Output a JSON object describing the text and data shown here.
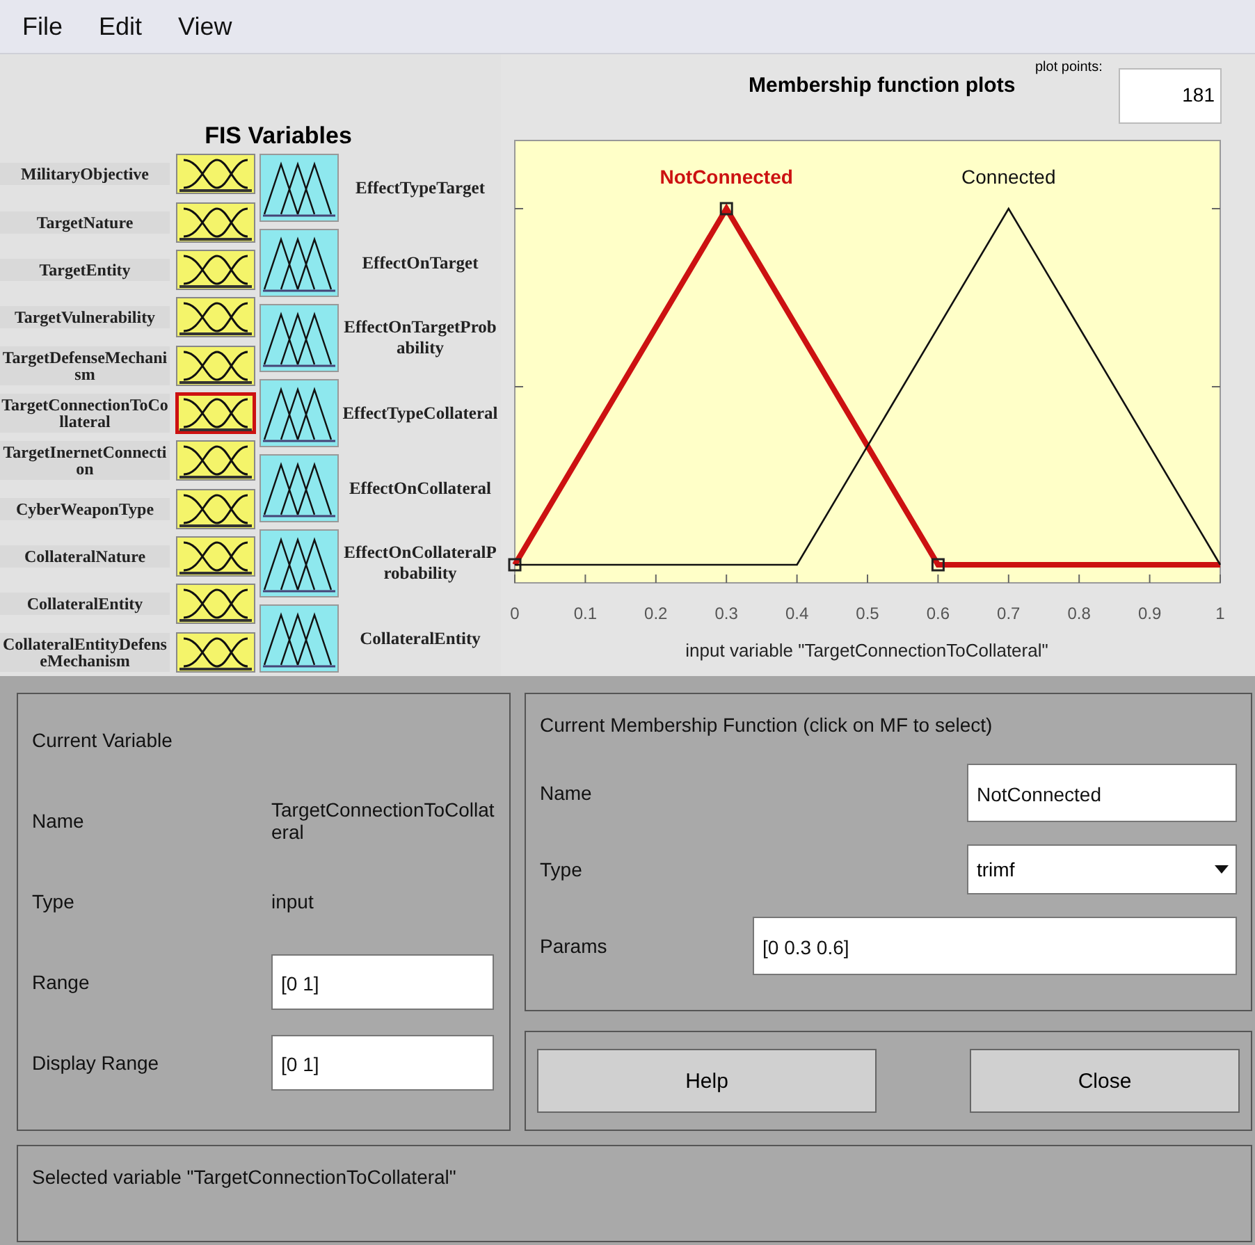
{
  "menu": [
    "File",
    "Edit",
    "View"
  ],
  "fis_variables": {
    "title": "FIS Variables",
    "inputs": [
      {
        "name": "MilitaryObjective",
        "selected": false
      },
      {
        "name": "TargetNature",
        "selected": false
      },
      {
        "name": "TargetEntity",
        "selected": false
      },
      {
        "name": "TargetVulnerability",
        "selected": false
      },
      {
        "name": "TargetDefenseMechanism",
        "selected": false
      },
      {
        "name": "TargetConnectionToCollateral",
        "selected": true
      },
      {
        "name": "TargetInernetConnection",
        "selected": false
      },
      {
        "name": "CyberWeaponType",
        "selected": false
      },
      {
        "name": "CollateralNature",
        "selected": false
      },
      {
        "name": "CollateralEntity",
        "selected": false
      },
      {
        "name": "CollateralEntityDefenseMechanism",
        "selected": false
      }
    ],
    "outputs": [
      "EffectTypeTarget",
      "EffectOnTarget",
      "EffectOnTargetProbability",
      "EffectTypeCollateral",
      "EffectOnCollateral",
      "EffectOnCollateralProbability",
      "CollateralEntity"
    ]
  },
  "plot": {
    "plot_points_label": "plot points:",
    "plot_points": "181",
    "title": "Membership function plots",
    "mfs": [
      {
        "name": "NotConnected",
        "color": "#cc1111",
        "selected": true
      },
      {
        "name": "Connected",
        "color": "#111111",
        "selected": false
      }
    ],
    "x_tick_labels": [
      "0",
      "0.1",
      "0.2",
      "0.3",
      "0.4",
      "0.5",
      "0.6",
      "0.7",
      "0.8",
      "0.9",
      "1"
    ],
    "xlabel": "input variable \"TargetConnectionToCollateral\""
  },
  "current_variable": {
    "title": "Current Variable",
    "fields": [
      {
        "kind": "text",
        "label": "Name",
        "value": "TargetConnectionToCollateral"
      },
      {
        "kind": "text",
        "label": "Type",
        "value": "input"
      },
      {
        "kind": "input",
        "label": "Range",
        "value": "[0 1]"
      },
      {
        "kind": "input",
        "label": "Display Range",
        "value": "[0 1]"
      }
    ]
  },
  "current_mf": {
    "title": "Current Membership Function (click on MF to select)",
    "name": {
      "label": "Name",
      "value": "NotConnected"
    },
    "type": {
      "label": "Type",
      "value": "trimf"
    },
    "params": {
      "label": "Params",
      "value": "[0 0.3 0.6]"
    }
  },
  "buttons": [
    "Help",
    "Close"
  ],
  "status_bar": "Selected variable \"TargetConnectionToCollateral\""
}
